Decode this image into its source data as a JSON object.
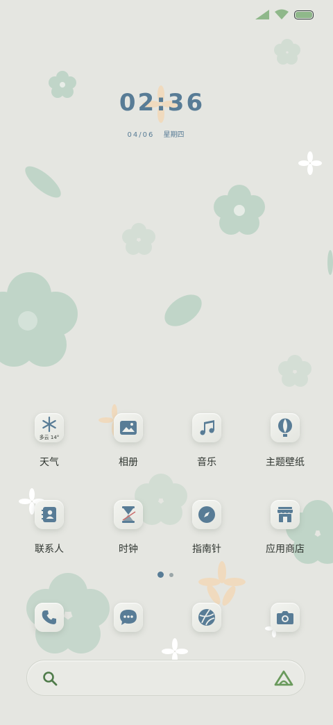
{
  "status_bar": {
    "signal_icon": "signal-icon",
    "wifi_icon": "wifi-icon",
    "battery_icon": "battery-icon",
    "battery_color": "#8fb88a"
  },
  "clock": {
    "time": "02:36",
    "date": "04/06",
    "weekday": "星期四"
  },
  "apps": [
    {
      "label": "天气",
      "icon": "snowflake-icon",
      "widget_text": "多云 14°"
    },
    {
      "label": "相册",
      "icon": "gallery-icon"
    },
    {
      "label": "音乐",
      "icon": "music-note-icon"
    },
    {
      "label": "主题壁纸",
      "icon": "hot-air-balloon-icon"
    },
    {
      "label": "联系人",
      "icon": "contacts-icon"
    },
    {
      "label": "时钟",
      "icon": "hourglass-icon"
    },
    {
      "label": "指南针",
      "icon": "compass-icon"
    },
    {
      "label": "应用商店",
      "icon": "store-icon"
    }
  ],
  "pager": {
    "pages": 2,
    "current": 1
  },
  "dock": [
    {
      "icon": "phone-icon"
    },
    {
      "icon": "message-icon"
    },
    {
      "icon": "browser-globe-icon"
    },
    {
      "icon": "camera-icon"
    }
  ],
  "search": {
    "placeholder": "",
    "search_icon": "search-icon",
    "assistant_icon": "assistant-logo-icon"
  },
  "colors": {
    "accent": "#587c96",
    "background": "#e5e6e1",
    "flower_green": "#b9d4c4",
    "flower_orange": "#f3d9b8"
  }
}
